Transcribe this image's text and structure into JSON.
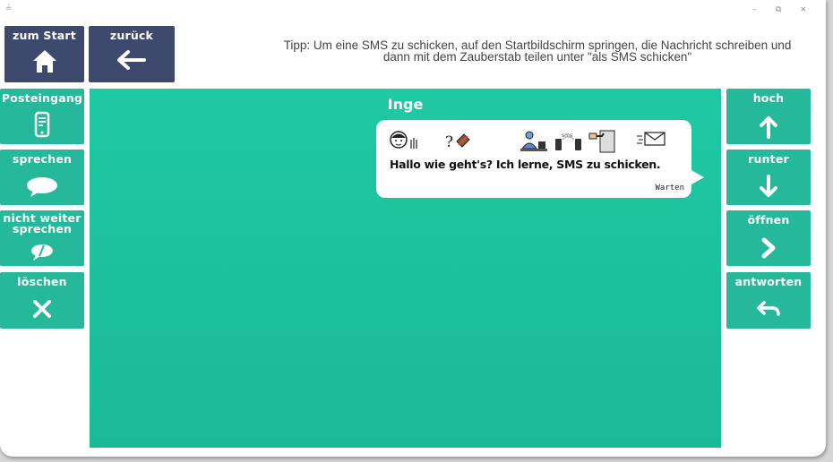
{
  "window": {
    "controls": [
      "–",
      "⧉",
      "×"
    ]
  },
  "nav": {
    "start_label": "zum Start",
    "back_label": "zurück"
  },
  "tip": "Tipp: Um eine SMS zu schicken, auf den Startbildschirm springen, die Nachricht schreiben und dann mit dem Zauberstab teilen unter \"als SMS schicken\"",
  "left_menu": [
    {
      "label": "Posteingang",
      "icon": "phone-icon"
    },
    {
      "label": "sprechen",
      "icon": "speech-bubble-icon"
    },
    {
      "label": "nicht weiter sprechen",
      "icon": "speech-bubble-mute-icon"
    },
    {
      "label": "löschen",
      "icon": "close-icon"
    }
  ],
  "right_menu": [
    {
      "label": "hoch",
      "icon": "arrow-up-icon"
    },
    {
      "label": "runter",
      "icon": "arrow-down-icon"
    },
    {
      "label": "öffnen",
      "icon": "chevron-right-icon"
    },
    {
      "label": "antworten",
      "icon": "reply-icon"
    }
  ],
  "conversation": {
    "contact": "Inge",
    "message": "Hallo wie geht's? Ich lerne, SMS  zu  schicken.",
    "status": "Warten",
    "symbols": [
      "person-waving-symbol",
      "question-symbol",
      "learning-symbol",
      "sms-phones-symbol",
      "send-symbol",
      "mail-symbol"
    ]
  },
  "colors": {
    "nav": "#3e4a6d",
    "teal_button": "#25b89b",
    "panel": "#1fc9a3"
  }
}
